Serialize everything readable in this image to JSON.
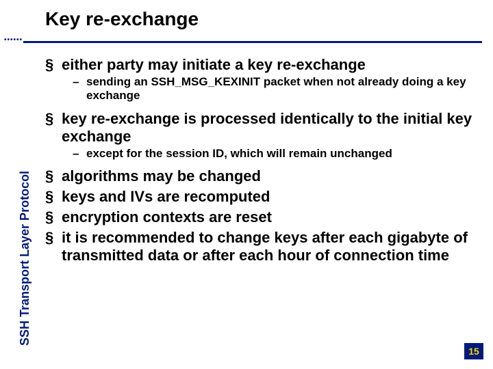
{
  "title": "Key re-exchange",
  "sidebar_label": "SSH Transport Layer Protocol",
  "page_number": "15",
  "bullets": {
    "b1": "either party may initiate a key re-exchange",
    "b1s1": "sending an SSH_MSG_KEXINIT packet when not already doing a key exchange",
    "b2": "key re-exchange is processed identically to the initial key exchange",
    "b2s1": "except for the session ID, which will remain unchanged",
    "b3": "algorithms may be changed",
    "b4": "keys and IVs are recomputed",
    "b5": "encryption contexts are reset",
    "b6": "it is recommended to change keys after each gigabyte of transmitted data or after each hour of connection time"
  }
}
